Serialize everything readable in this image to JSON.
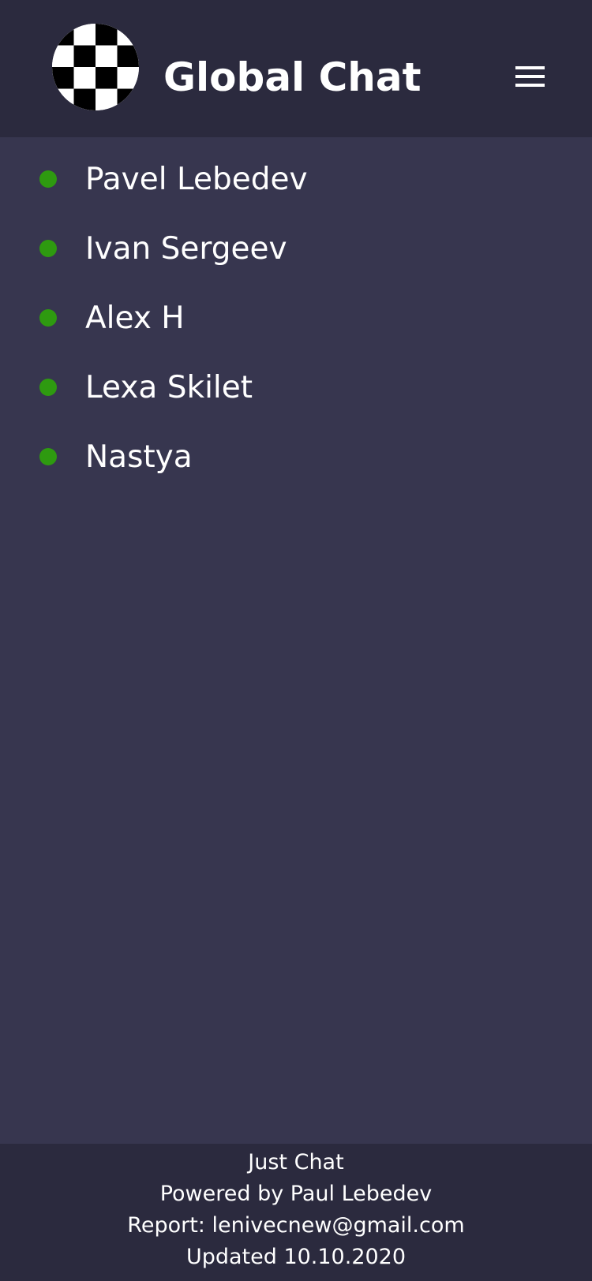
{
  "header": {
    "title": "Global Chat",
    "logo_icon": "checkered-logo-icon",
    "menu_icon": "hamburger-menu-icon"
  },
  "users": [
    {
      "name": "Pavel Lebedev",
      "status": "online"
    },
    {
      "name": "Ivan Sergeev",
      "status": "online"
    },
    {
      "name": "Alex H",
      "status": "online"
    },
    {
      "name": "Lexa Skilet",
      "status": "online"
    },
    {
      "name": "Nastya",
      "status": "online"
    }
  ],
  "footer": {
    "app_name": "Just Chat",
    "powered_by": "Powered by Paul Lebedev",
    "report": "Report:  lenivecnew@gmail.com",
    "updated": "Updated 10.10.2020"
  },
  "colors": {
    "background": "#37364f",
    "header_bg": "#2b2a3e",
    "online_status": "#2e9a10",
    "text": "#ffffff"
  }
}
